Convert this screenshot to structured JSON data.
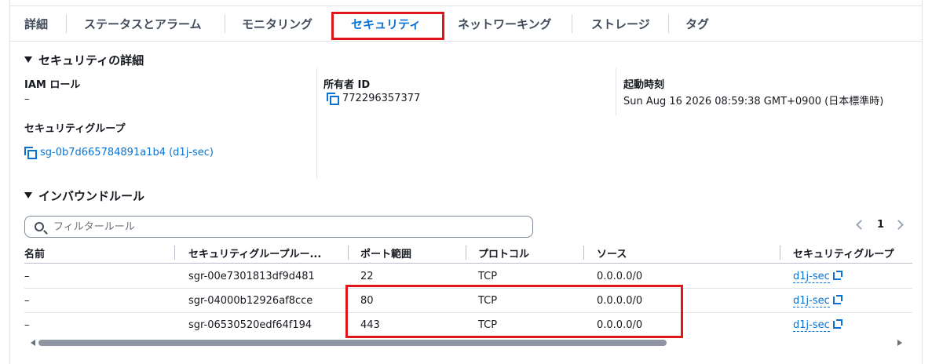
{
  "tabs": [
    {
      "label": "詳細"
    },
    {
      "label": "ステータスとアラーム"
    },
    {
      "label": "モニタリング"
    },
    {
      "label": "セキュリティ",
      "active": true
    },
    {
      "label": "ネットワーキング"
    },
    {
      "label": "ストレージ"
    },
    {
      "label": "タグ"
    }
  ],
  "security_details": {
    "title": "セキュリティの詳細",
    "iam_role_label": "IAM ロール",
    "iam_role_value": "–",
    "security_groups_label": "セキュリティグループ",
    "security_group_link": "sg-0b7d665784891a1b4 (d1j-sec)",
    "owner_id_label": "所有者 ID",
    "owner_id_value": "772296357377",
    "launch_time_label": "起動時刻",
    "launch_time_value": "Sun Aug 16 2026 08:59:38 GMT+0900 (日本標準時)"
  },
  "inbound_rules": {
    "title": "インバウンドルール",
    "filter_placeholder": "フィルタールール",
    "current_page": "1",
    "columns": [
      "名前",
      "セキュリティグループルー...",
      "ポート範囲",
      "プロトコル",
      "ソース",
      "セキュリティグループ"
    ],
    "rows": [
      {
        "name": "–",
        "rule_id": "sgr-00e7301813df9d481",
        "port": "22",
        "protocol": "TCP",
        "source": "0.0.0.0/0",
        "group": "d1j-sec"
      },
      {
        "name": "–",
        "rule_id": "sgr-04000b12926af8cce",
        "port": "80",
        "protocol": "TCP",
        "source": "0.0.0.0/0",
        "group": "d1j-sec"
      },
      {
        "name": "–",
        "rule_id": "sgr-06530520edf64f194",
        "port": "443",
        "protocol": "TCP",
        "source": "0.0.0.0/0",
        "group": "d1j-sec"
      }
    ]
  },
  "colors": {
    "accent": "#0972d3",
    "highlight": "#e0161b",
    "text": "#16191f"
  }
}
